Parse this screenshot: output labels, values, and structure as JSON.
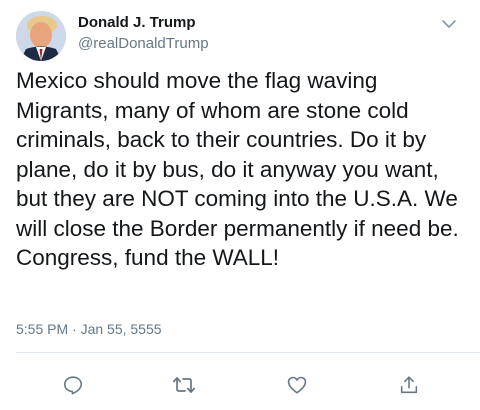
{
  "author": {
    "display_name": "Donald J. Trump",
    "handle": "@realDonaldTrump"
  },
  "tweet": {
    "text": "Mexico should move the flag waving Migrants, many of whom are stone cold criminals, back to their countries. Do it by plane, do it by bus, do it anyway you want, but they are NOT coming into the U.S.A. We will close the Border permanently if need be. Congress, fund the WALL!",
    "timestamp": "5:55 PM · Jan 55, 5555"
  },
  "icons": {
    "menu": "chevron-down-icon",
    "reply": "reply-icon",
    "retweet": "retweet-icon",
    "like": "heart-icon",
    "share": "share-icon"
  },
  "colors": {
    "text": "#14171a",
    "secondary": "#657786",
    "divider": "#e1e8ed"
  }
}
